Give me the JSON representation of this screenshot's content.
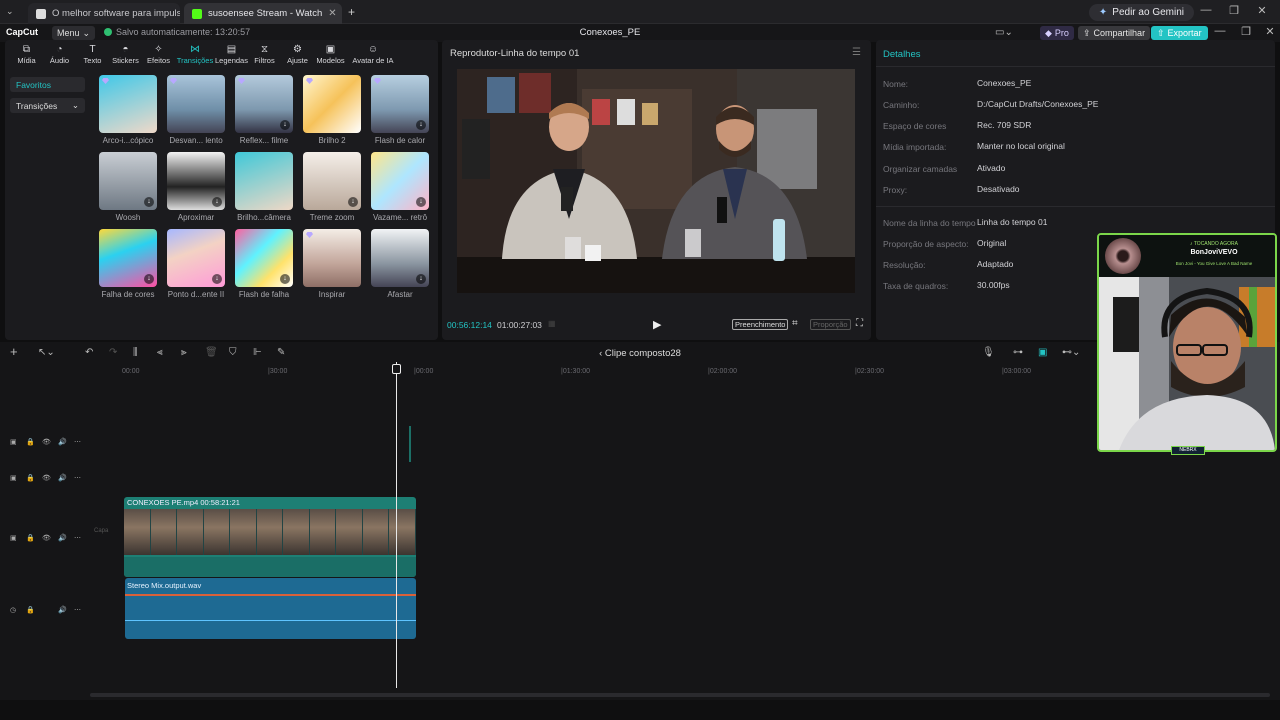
{
  "browser": {
    "tabs": [
      {
        "title": "O melhor software para impulsi",
        "active": false
      },
      {
        "title": "susoensee Stream - Watch",
        "active": true
      }
    ],
    "new_tab": "+",
    "gemini_label": "Pedir ao Gemini"
  },
  "app": {
    "logo": "CapCut",
    "menu_label": "Menu",
    "autosave": "Salvo automaticamente: 13:20:57",
    "project_title": "Conexoes_PE",
    "pro_label": "Pro",
    "share_label": "Compartilhar",
    "export_label": "Exportar",
    "accent": "#23c4c4"
  },
  "toolbar": [
    {
      "label": "Mídia",
      "icon": "media-icon"
    },
    {
      "label": "Áudio",
      "icon": "audio-icon"
    },
    {
      "label": "Texto",
      "icon": "text-icon"
    },
    {
      "label": "Stickers",
      "icon": "sticker-icon"
    },
    {
      "label": "Efeitos",
      "icon": "effects-icon"
    },
    {
      "label": "Transições",
      "icon": "transitions-icon",
      "active": true
    },
    {
      "label": "Legendas",
      "icon": "captions-icon"
    },
    {
      "label": "Filtros",
      "icon": "filters-icon"
    },
    {
      "label": "Ajuste",
      "icon": "adjust-icon"
    },
    {
      "label": "Modelos",
      "icon": "templates-icon"
    },
    {
      "label": "Avatar de IA",
      "icon": "ai-avatar-icon"
    }
  ],
  "categories": {
    "favorites": "Favoritos",
    "transitions": "Transições"
  },
  "transitions": [
    {
      "label": "Arco-i...cópico"
    },
    {
      "label": "Desvan... lento"
    },
    {
      "label": "Reflex... filme"
    },
    {
      "label": "Brilho 2"
    },
    {
      "label": "Flash de calor"
    },
    {
      "label": "Woosh"
    },
    {
      "label": "Aproximar"
    },
    {
      "label": "Brilho...câmera"
    },
    {
      "label": "Treme zoom"
    },
    {
      "label": "Vazame... retrô"
    },
    {
      "label": "Falha de cores"
    },
    {
      "label": "Ponto d...ente II"
    },
    {
      "label": "Flash de falha"
    },
    {
      "label": "Inspirar"
    },
    {
      "label": "Afastar"
    }
  ],
  "player": {
    "title": "Reprodutor-Linha do tempo 01",
    "current_time": "00:56:12:14",
    "duration": "01:00:27:03",
    "fill_label": "Preenchimento",
    "ratio_label": "Proporção"
  },
  "details": {
    "title": "Detalhes",
    "rows": [
      {
        "key": "Nome:",
        "value": "Conexoes_PE"
      },
      {
        "key": "Caminho:",
        "value": "D:/CapCut Drafts/Conexoes_PE"
      },
      {
        "key": "Espaço de cores",
        "value": "Rec. 709 SDR"
      },
      {
        "key": "Mídia importada:",
        "value": "Manter no local original"
      },
      {
        "key": "Organizar camadas",
        "value": "Ativado"
      },
      {
        "key": "Proxy:",
        "value": "Desativado"
      },
      {
        "key": "Nome da linha do tempo",
        "value": "Linha do tempo 01"
      },
      {
        "key": "Proporção de aspecto:",
        "value": "Original"
      },
      {
        "key": "Resolução:",
        "value": "Adaptado"
      },
      {
        "key": "Taxa de quadros:",
        "value": "30.00fps"
      }
    ]
  },
  "timeline": {
    "compound_name": "Clipe composto28",
    "ticks": [
      "00:00",
      "|30:00",
      "|00:00",
      "|01:30:00",
      "|02:00:00",
      "|02:30:00",
      "|03:00:00"
    ],
    "cover_label": "Capa",
    "video_clip": "CONEXOES PE.mp4   00:58:21:21",
    "audio_clip": "Stereo Mix.output.wav"
  },
  "webcam": {
    "heading": "♪ TOCANDO AGORA",
    "channel": "BonJoviVEVO",
    "song": "Bon Jovi - You Give Love A Bad Name",
    "badge": "NEBRX"
  }
}
